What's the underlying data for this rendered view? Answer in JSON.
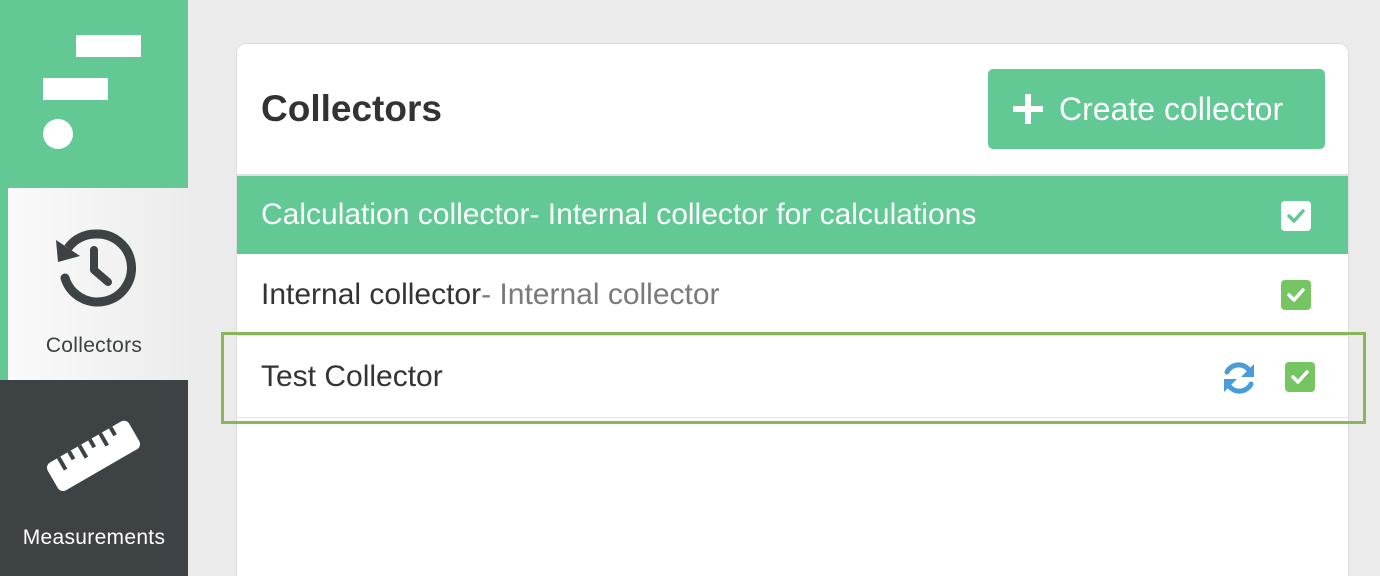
{
  "sidebar": {
    "logo_icon": "app-logo-icon",
    "items": [
      {
        "label": "Collectors",
        "icon": "history-icon",
        "active": true
      },
      {
        "label": "Measurements",
        "icon": "ruler-icon",
        "active": false
      }
    ]
  },
  "panel": {
    "title": "Collectors",
    "create_button_label": "Create collector"
  },
  "collectors": [
    {
      "name": "Calculation collector",
      "description": " - Internal collector for calculations",
      "enabled": true,
      "selected": true
    },
    {
      "name": "Internal collector",
      "description": " - Internal collector",
      "enabled": true,
      "selected": false
    },
    {
      "name": "Test Collector",
      "description": "",
      "enabled": true,
      "selected": false,
      "sync_icon": "refresh-icon"
    }
  ],
  "colors": {
    "brand_green": "#62c995",
    "checkbox_green": "#76c563",
    "dark_nav": "#3d4244",
    "sync_blue": "#4a9bd9",
    "highlight_border": "#8ab55a"
  }
}
